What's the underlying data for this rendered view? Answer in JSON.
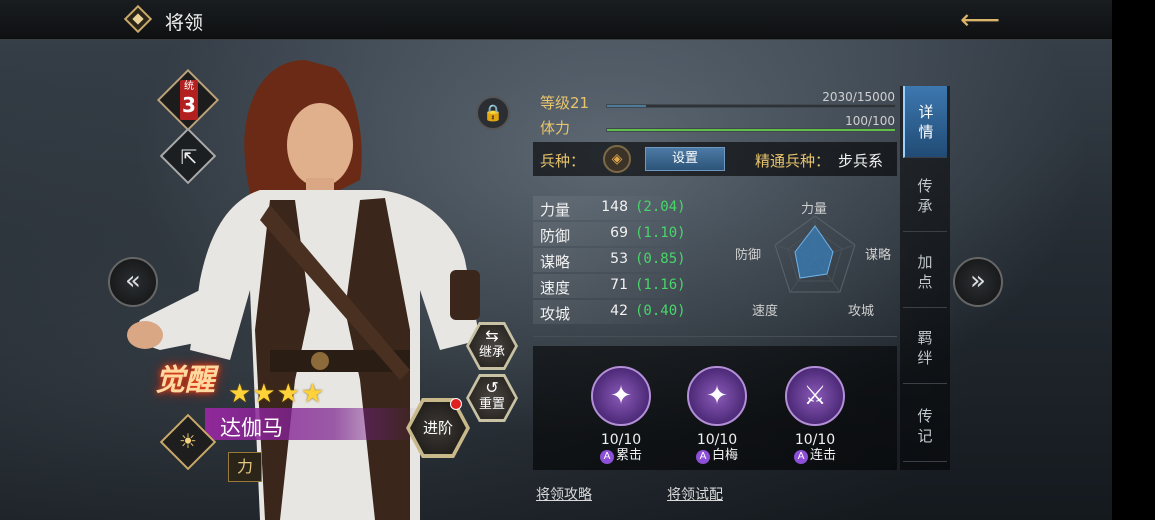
{
  "header": {
    "title": "将领"
  },
  "hero": {
    "tong_label": "统",
    "tong_value": "3",
    "awaken_label": "觉醒",
    "stars": "★★★★",
    "name": "达伽马",
    "type_label": "力"
  },
  "actions": {
    "inherit": "继承",
    "reset": "重置",
    "advance": "进阶"
  },
  "level": {
    "label": "等级21",
    "exp_text": "2030/15000",
    "exp_fraction": 0.135
  },
  "stamina": {
    "label": "体力",
    "text": "100/100",
    "fraction": 1.0
  },
  "troop": {
    "label": "兵种：",
    "set_button": "设置",
    "master_label": "精通兵种：",
    "master_value": "步兵系"
  },
  "stats": [
    {
      "name": "力量",
      "value": "148",
      "growth": "(2.04)"
    },
    {
      "name": "防御",
      "value": "69",
      "growth": "(1.10)"
    },
    {
      "name": "谋略",
      "value": "53",
      "growth": "(0.85)"
    },
    {
      "name": "速度",
      "value": "71",
      "growth": "(1.16)"
    },
    {
      "name": "攻城",
      "value": "42",
      "growth": "(0.40)"
    }
  ],
  "radar_labels": {
    "top": "力量",
    "right": "谋略",
    "bottom_right": "攻城",
    "bottom_left": "速度",
    "left": "防御"
  },
  "skills": [
    {
      "level": "10/10",
      "tag": "A",
      "name": "累击"
    },
    {
      "level": "10/10",
      "tag": "A",
      "name": "白梅"
    },
    {
      "level": "10/10",
      "tag": "A",
      "name": "连击"
    }
  ],
  "links": {
    "guide": "将领攻略",
    "trial": "将领试配"
  },
  "tabs": [
    "详情",
    "传承",
    "加点",
    "羁绊",
    "传记"
  ],
  "colors": {
    "accent_gold": "#e8c46c",
    "growth_green": "#48d66a",
    "tab_active": "#3d78b0",
    "skill_purple": "#8a5ab8"
  }
}
